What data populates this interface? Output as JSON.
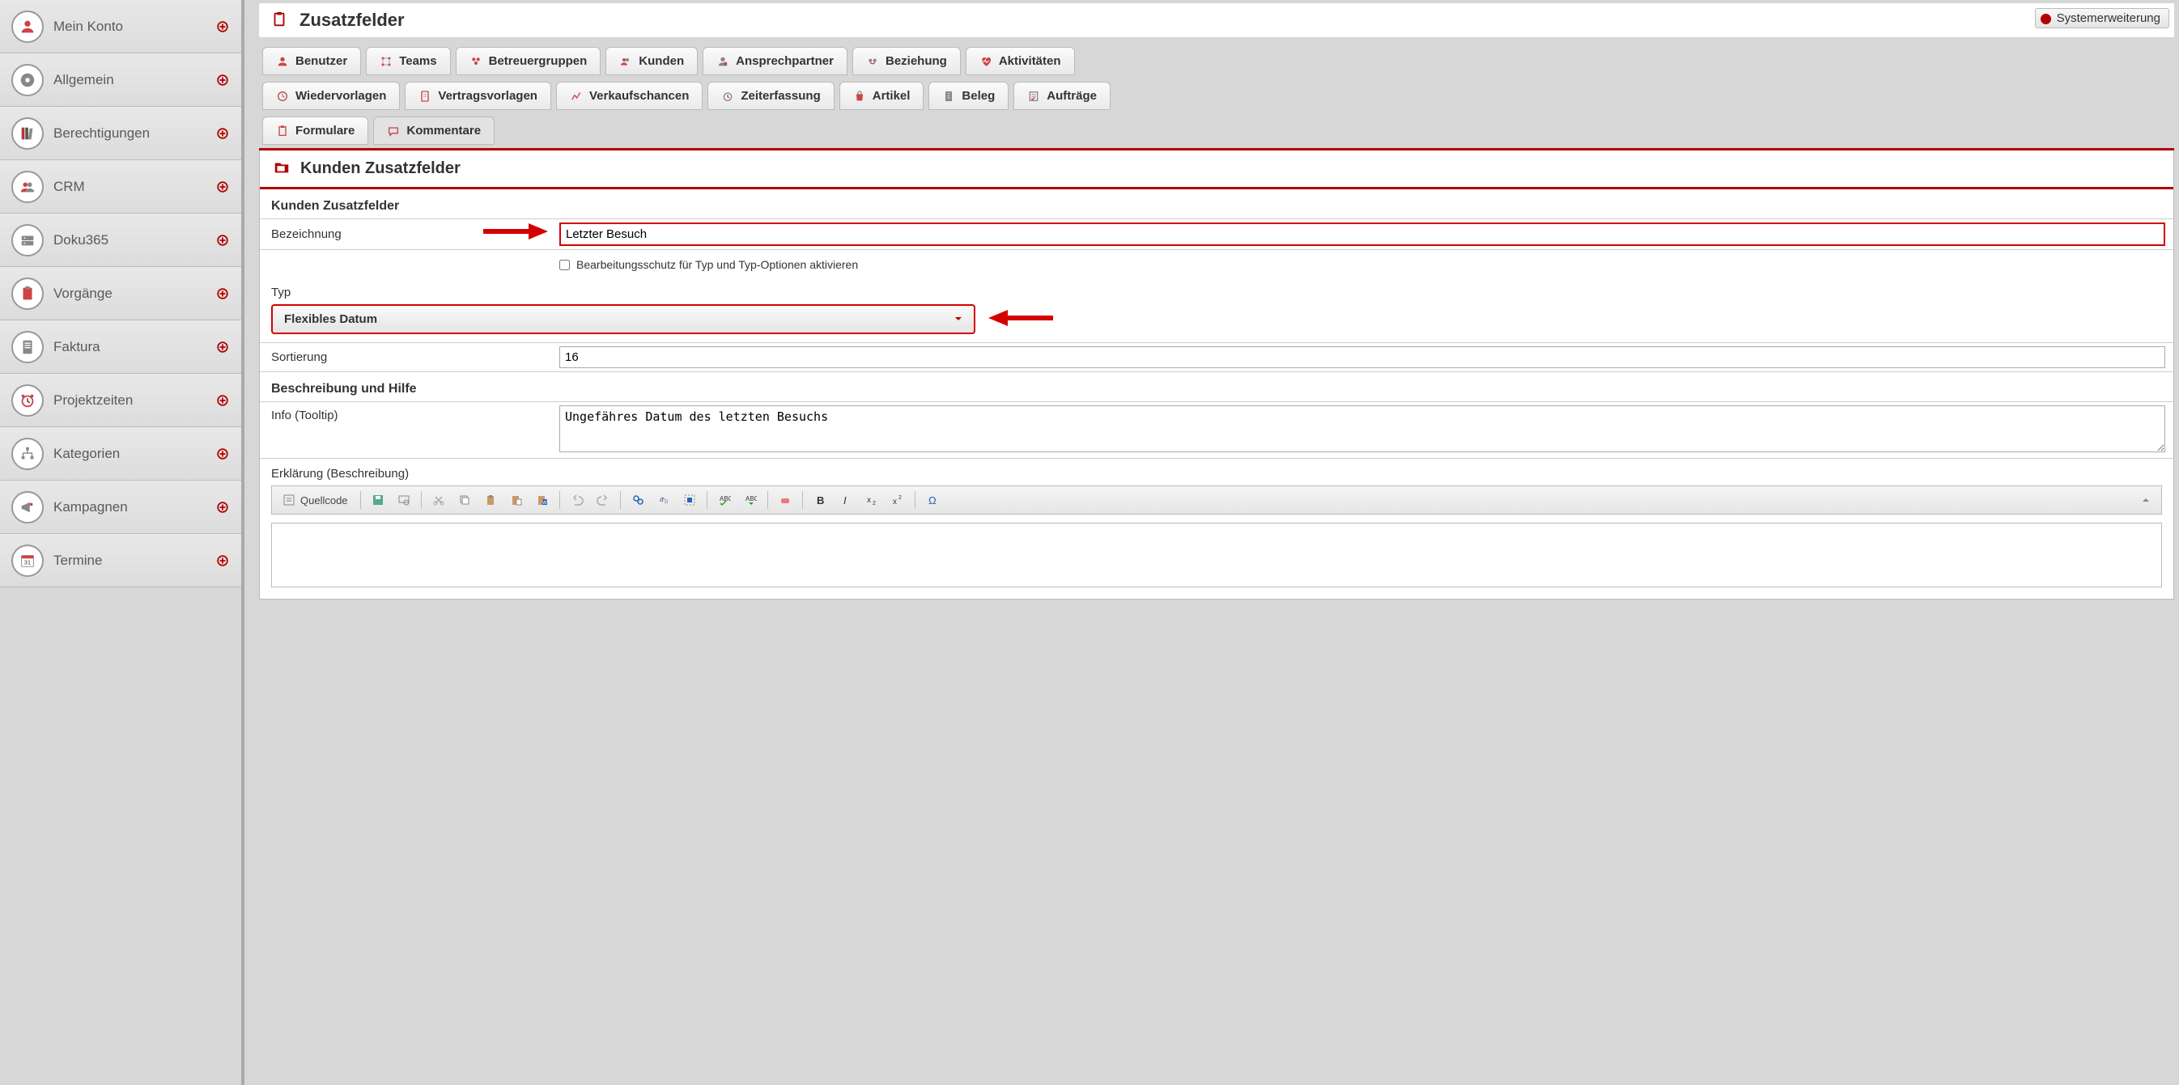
{
  "sidebar": {
    "items": [
      {
        "label": "Mein Konto"
      },
      {
        "label": "Allgemein"
      },
      {
        "label": "Berechtigungen"
      },
      {
        "label": "CRM"
      },
      {
        "label": "Doku365"
      },
      {
        "label": "Vorgänge"
      },
      {
        "label": "Faktura"
      },
      {
        "label": "Projektzeiten"
      },
      {
        "label": "Kategorien"
      },
      {
        "label": "Kampagnen"
      },
      {
        "label": "Termine"
      }
    ]
  },
  "header": {
    "title": "Zusatzfelder",
    "badge": "Systemerweiterung"
  },
  "tabs": {
    "row1": [
      {
        "label": "Benutzer"
      },
      {
        "label": "Teams"
      },
      {
        "label": "Betreuergruppen"
      },
      {
        "label": "Kunden"
      },
      {
        "label": "Ansprechpartner"
      },
      {
        "label": "Beziehung"
      },
      {
        "label": "Aktivitäten"
      }
    ],
    "row2": [
      {
        "label": "Wiedervorlagen"
      },
      {
        "label": "Vertragsvorlagen"
      },
      {
        "label": "Verkaufschancen"
      },
      {
        "label": "Zeiterfassung"
      },
      {
        "label": "Artikel"
      },
      {
        "label": "Beleg"
      },
      {
        "label": "Aufträge"
      }
    ],
    "row3": [
      {
        "label": "Formulare"
      },
      {
        "label": "Kommentare"
      }
    ]
  },
  "panel": {
    "title": "Kunden Zusatzfelder",
    "section1": "Kunden Zusatzfelder",
    "bezeichnung_label": "Bezeichnung",
    "bezeichnung_value": "Letzter Besuch",
    "schutz_label": "Bearbeitungsschutz für Typ und Typ-Optionen aktivieren",
    "typ_label": "Typ",
    "typ_value": "Flexibles Datum",
    "sort_label": "Sortierung",
    "sort_value": "16",
    "section2": "Beschreibung und Hilfe",
    "info_label": "Info (Tooltip)",
    "info_value": "Ungefähres Datum des letzten Besuchs",
    "erk_label": "Erklärung (Beschreibung)",
    "quellcode": "Quellcode"
  }
}
